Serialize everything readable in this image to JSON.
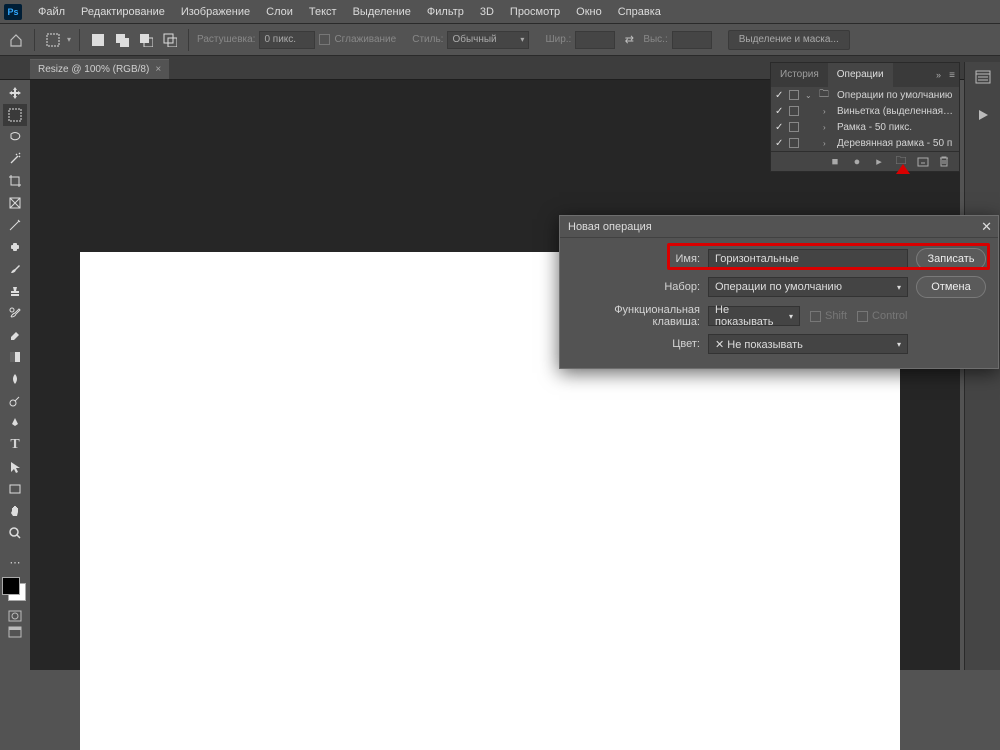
{
  "menu": [
    "Файл",
    "Редактирование",
    "Изображение",
    "Слои",
    "Текст",
    "Выделение",
    "Фильтр",
    "3D",
    "Просмотр",
    "Окно",
    "Справка"
  ],
  "options": {
    "rasterize": "Растушевка:",
    "rasterize_val": "0 пикс.",
    "smoothing": "Сглаживание",
    "style": "Стиль:",
    "style_val": "Обычный",
    "width": "Шир.:",
    "height": "Выс.:",
    "mask_btn": "Выделение и маска..."
  },
  "doc_tab": "Resize @ 100% (RGB/8)",
  "panel": {
    "tab_history": "История",
    "tab_actions": "Операции",
    "rows": [
      {
        "folder": true,
        "txt": "Операции по умолчанию"
      },
      {
        "folder": false,
        "txt": "Виньетка (выделенная о..."
      },
      {
        "folder": false,
        "txt": "Рамка - 50 пикс."
      },
      {
        "folder": false,
        "txt": "Деревянная рамка - 50 п"
      }
    ]
  },
  "dialog": {
    "title": "Новая операция",
    "name_label": "Имя:",
    "name_val": "Горизонтальные",
    "set_label": "Набор:",
    "set_val": "Операции по умолчанию",
    "fkey_label": "Функциональная клавиша:",
    "fkey_val": "Не показывать",
    "shift": "Shift",
    "control": "Control",
    "color_label": "Цвет:",
    "color_val": "Не показывать",
    "record": "Записать",
    "cancel": "Отмена"
  }
}
